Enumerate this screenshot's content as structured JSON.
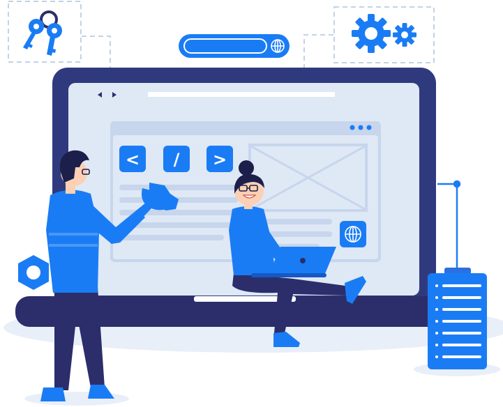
{
  "code_buttons": {
    "open_tag": "<",
    "slash": "/",
    "close_tag": ">"
  },
  "icons": {
    "keys": "keys-icon",
    "gears": "gears-icon",
    "globe": "globe-icon",
    "search": "search-bar-icon",
    "wrench": "wrench-icon",
    "hex_nut": "hex-nut-icon",
    "server": "server-icon",
    "image_placeholder": "image-placeholder-icon",
    "laptop": "laptop-icon"
  },
  "colors": {
    "primary_blue": "#1a7cf5",
    "navy": "#2b2e6b",
    "light_panel": "#dfe8f5",
    "mid_panel": "#c7d6ec",
    "ground": "#e9eff8",
    "skin": "#fbd0b4",
    "hair": "#1c1f4a"
  }
}
